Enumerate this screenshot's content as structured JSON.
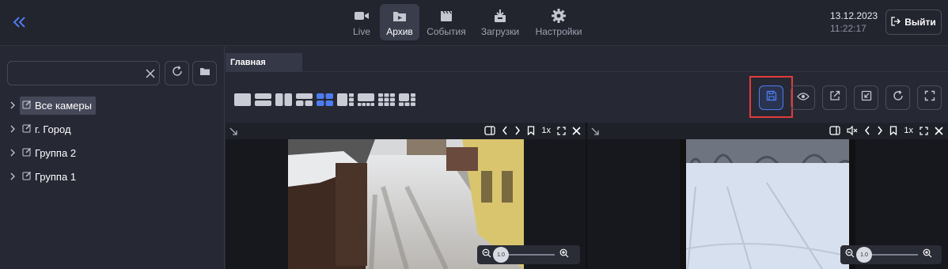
{
  "header": {
    "nav": [
      {
        "label": "Live",
        "icon": "video-camera-icon"
      },
      {
        "label": "Архив",
        "icon": "archive-folder-icon",
        "active": true
      },
      {
        "label": "События",
        "icon": "clapperboard-icon"
      },
      {
        "label": "Загрузки",
        "icon": "download-tray-icon"
      },
      {
        "label": "Настройки",
        "icon": "gear-icon"
      }
    ],
    "date": "13.12.2023",
    "time": "11:22:17",
    "logout_label": "Выйти"
  },
  "sidebar": {
    "search": {
      "value": "",
      "placeholder": ""
    },
    "tree": [
      {
        "label": "Все камеры",
        "selected": true
      },
      {
        "label": "г. Город"
      },
      {
        "label": "Группа 2"
      },
      {
        "label": "Группа 1"
      }
    ]
  },
  "main": {
    "tabs": [
      {
        "label": "Главная"
      }
    ],
    "toolbar_icons": [
      "save-icon",
      "eye-icon",
      "export-icon",
      "window-restore-icon",
      "refresh-icon",
      "fullscreen-icon"
    ],
    "cells": [
      {
        "speed": "1x",
        "zoom": "1.0"
      },
      {
        "speed": "1x",
        "zoom": "1.0"
      }
    ]
  },
  "colors": {
    "accent": "#4d7cf0",
    "highlight": "#e23b3b",
    "background": "#262834"
  }
}
